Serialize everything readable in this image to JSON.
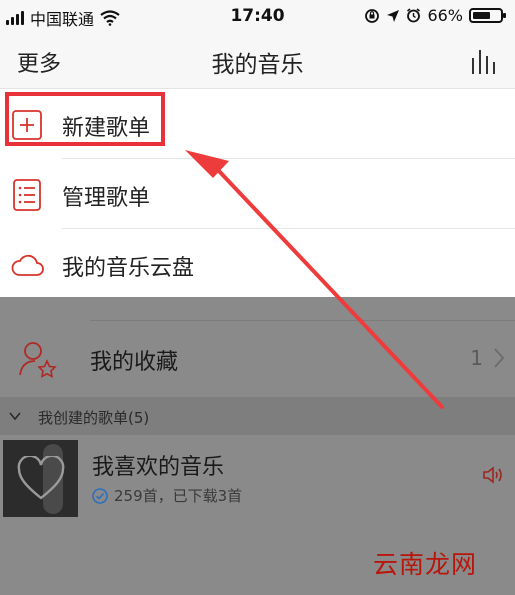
{
  "status_bar": {
    "carrier": "中国联通",
    "time": "17:40",
    "battery_percent": "66%",
    "battery_level": 0.66
  },
  "nav": {
    "back_label": "更多",
    "title": "我的音乐"
  },
  "menu": {
    "items": [
      {
        "label": "新建歌单",
        "icon": "plus-square-icon"
      },
      {
        "label": "管理歌单",
        "icon": "list-icon"
      },
      {
        "label": "我的音乐云盘",
        "icon": "cloud-icon"
      }
    ]
  },
  "favorites": {
    "label": "我的收藏",
    "count": "1"
  },
  "created_section": {
    "label": "我创建的歌单(5)"
  },
  "playlist": {
    "name": "我喜欢的音乐",
    "subtitle": "259首，已下载3首"
  },
  "watermark": "云南龙网",
  "colors": {
    "accent_red": "#e8323a",
    "dim_overlay": "#8a8a8a",
    "download_blue": "#2c7fd9"
  }
}
